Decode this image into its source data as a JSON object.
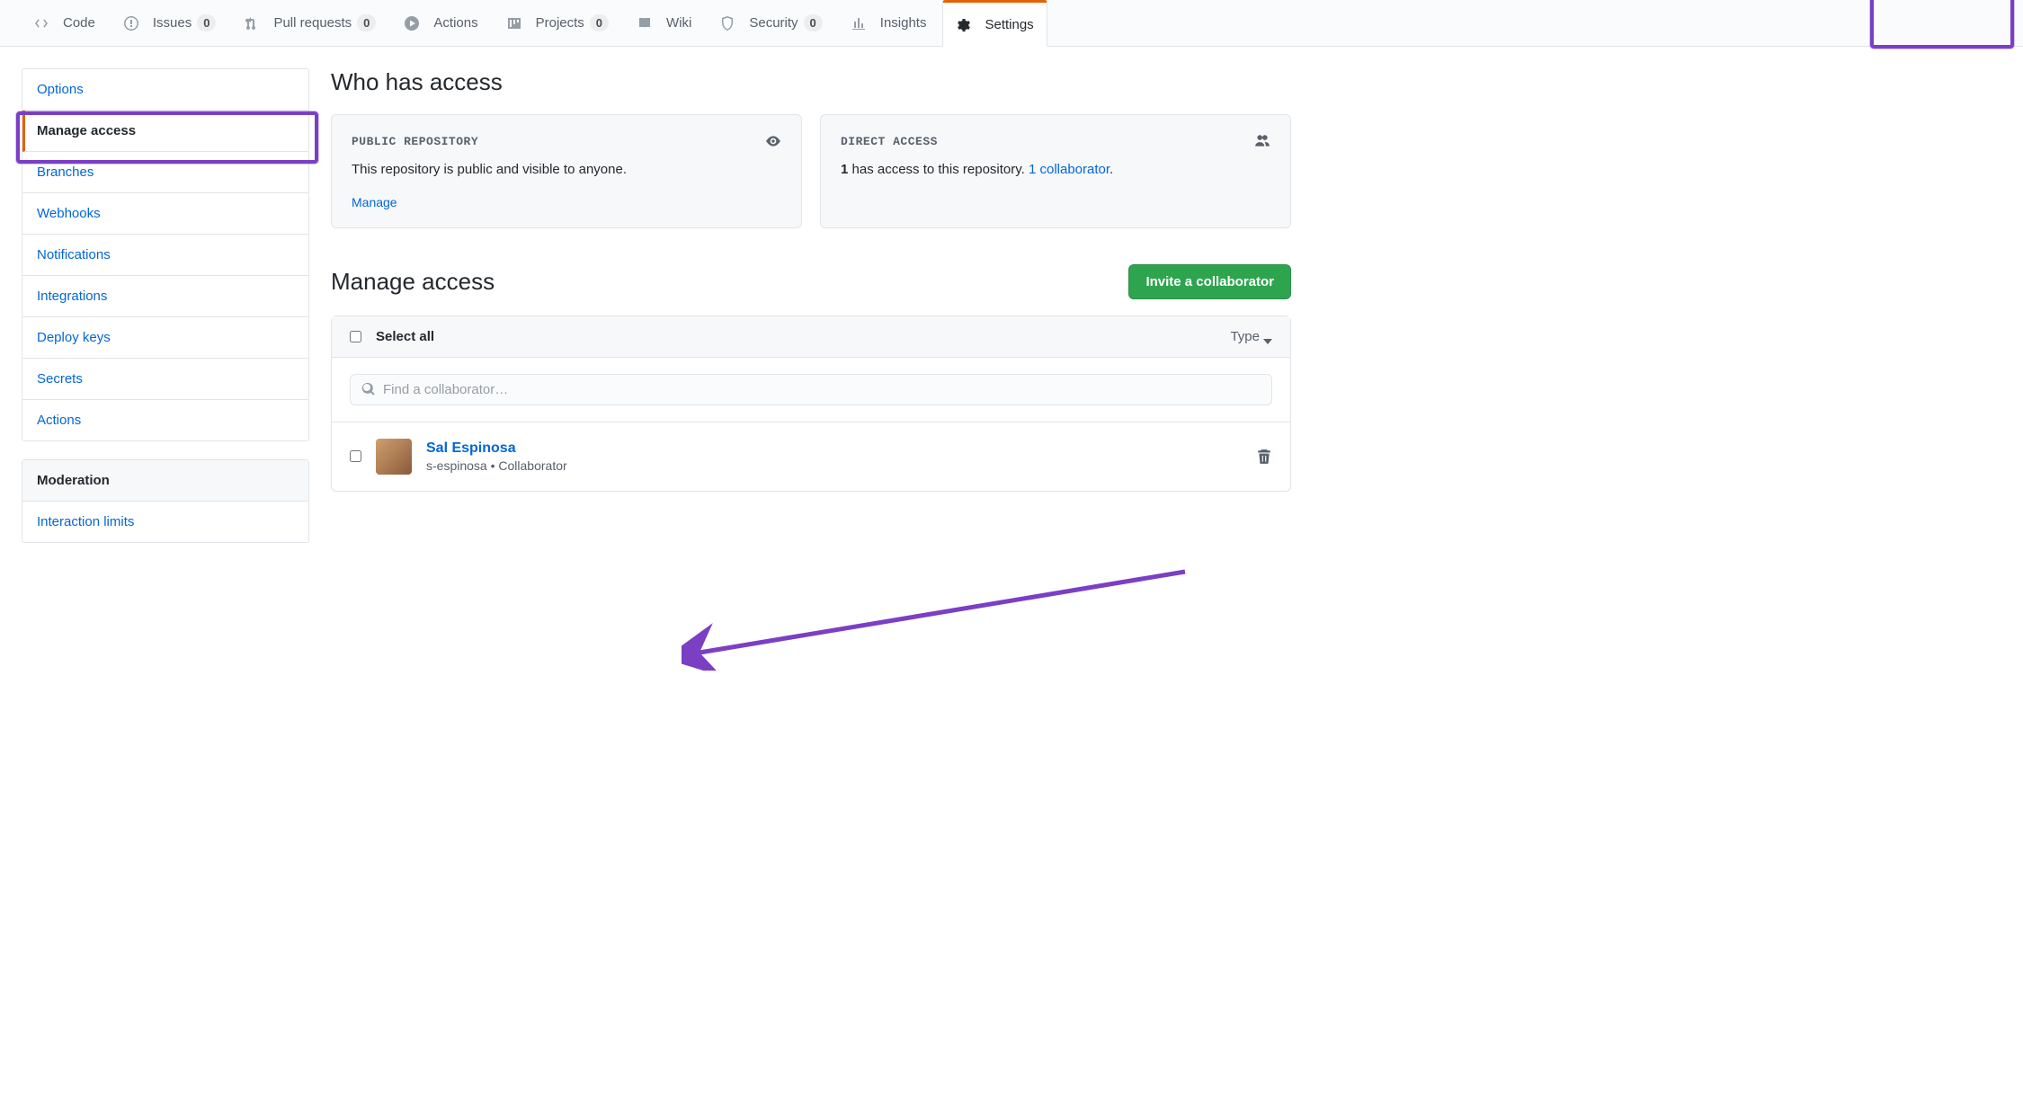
{
  "tabs": {
    "code": {
      "label": "Code"
    },
    "issues": {
      "label": "Issues",
      "count": "0"
    },
    "pulls": {
      "label": "Pull requests",
      "count": "0"
    },
    "actions": {
      "label": "Actions"
    },
    "projects": {
      "label": "Projects",
      "count": "0"
    },
    "wiki": {
      "label": "Wiki"
    },
    "security": {
      "label": "Security",
      "count": "0"
    },
    "insights": {
      "label": "Insights"
    },
    "settings": {
      "label": "Settings"
    }
  },
  "sidebar": {
    "items": [
      {
        "label": "Options"
      },
      {
        "label": "Manage access"
      },
      {
        "label": "Branches"
      },
      {
        "label": "Webhooks"
      },
      {
        "label": "Notifications"
      },
      {
        "label": "Integrations"
      },
      {
        "label": "Deploy keys"
      },
      {
        "label": "Secrets"
      },
      {
        "label": "Actions"
      }
    ],
    "moderation_heading": "Moderation",
    "moderation_items": [
      {
        "label": "Interaction limits"
      }
    ]
  },
  "who": {
    "title": "Who has access",
    "public_heading": "PUBLIC REPOSITORY",
    "public_text": "This repository is public and visible to anyone.",
    "public_manage": "Manage",
    "direct_heading": "DIRECT ACCESS",
    "direct_count": "1",
    "direct_text_rest": " has access to this repository. ",
    "direct_link": "1 collaborator",
    "direct_period": "."
  },
  "manage": {
    "title": "Manage access",
    "invite_btn": "Invite a collaborator",
    "select_all": "Select all",
    "type_filter": "Type",
    "search_placeholder": "Find a collaborator…",
    "collaborators": [
      {
        "name": "Sal Espinosa",
        "username": "s-espinosa",
        "role": "Collaborator",
        "sep": " • "
      }
    ]
  }
}
